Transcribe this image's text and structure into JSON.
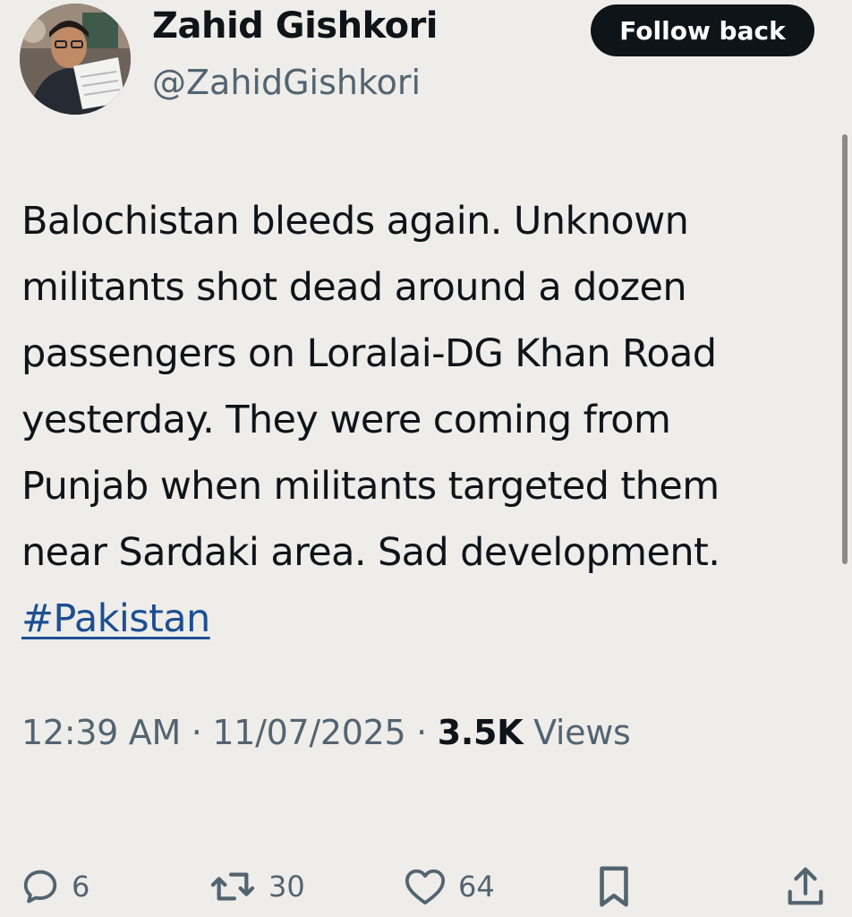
{
  "author": {
    "display_name": "Zahid Gishkori",
    "handle": "@ZahidGishkori",
    "follow_label": "Follow back",
    "avatar_icon": "profile-photo"
  },
  "tweet": {
    "lines": [
      "Balochistan bleeds again. Unknown",
      "militants shot dead around a dozen",
      "passengers on Loralai-DG Khan Road",
      "yesterday. They were coming from",
      "Punjab when militants targeted them",
      "near Sardaki area. Sad development."
    ],
    "hashtag": "#Pakistan",
    "time": "12:39 AM",
    "date": "11/07/2025",
    "separator": "·",
    "views_count": "3.5K",
    "views_label": "Views"
  },
  "actions": {
    "reply": {
      "icon": "reply-icon",
      "count": "6"
    },
    "retweet": {
      "icon": "retweet-icon",
      "count": "30"
    },
    "like": {
      "icon": "heart-icon",
      "count": "64"
    },
    "bookmark": {
      "icon": "bookmark-icon"
    },
    "share": {
      "icon": "share-icon"
    }
  },
  "colors": {
    "background": "#eeedea",
    "text": "#0f1419",
    "secondary": "#536471",
    "link": "#1d4f91",
    "button_bg": "#0f1419"
  }
}
